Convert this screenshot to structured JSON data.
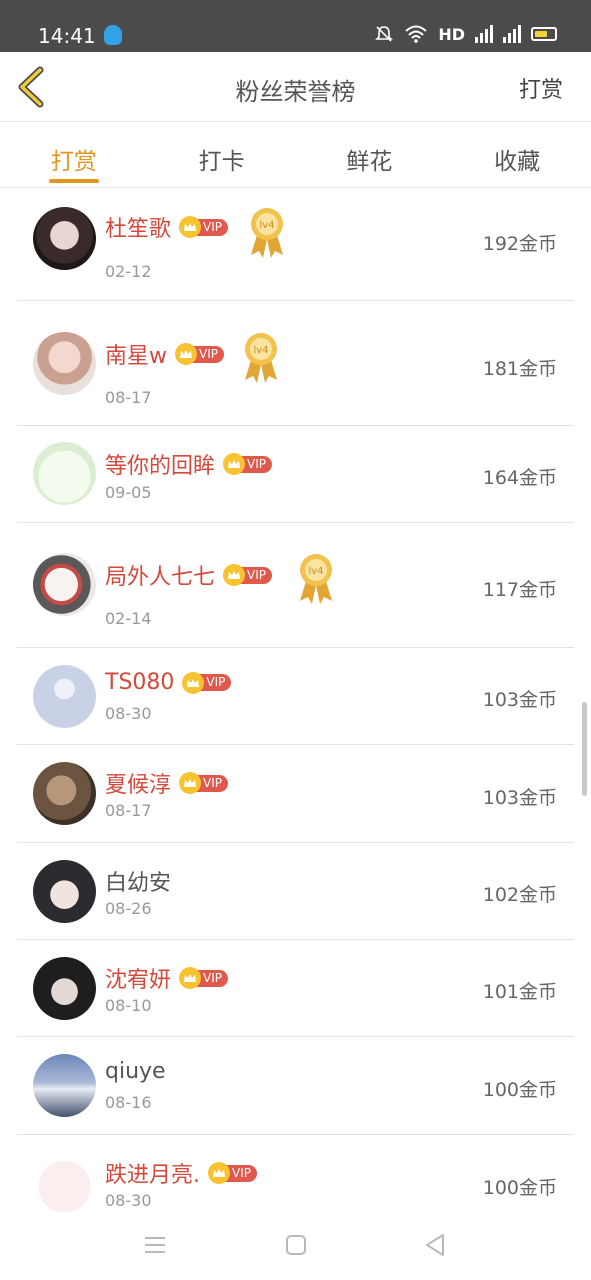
{
  "status_bar": {
    "time": "14:41",
    "network": "HD",
    "network_sub": "4G"
  },
  "nav": {
    "title": "粉丝荣誉榜",
    "action": "打赏"
  },
  "tabs": [
    {
      "label": "打赏",
      "active": true
    },
    {
      "label": "打卡",
      "active": false
    },
    {
      "label": "鲜花",
      "active": false
    },
    {
      "label": "收藏",
      "active": false
    }
  ],
  "colors": {
    "accent": "#e3961e",
    "vip_red": "#e0594c",
    "name_red": "#d4493b",
    "crown": "#f7c331"
  },
  "medal_label": "lv4",
  "list": [
    {
      "name": "杜笙歌",
      "vip": true,
      "medal": true,
      "date": "02-12",
      "coins": "192金币"
    },
    {
      "name": "南星w",
      "vip": true,
      "medal": true,
      "date": "08-17",
      "coins": "181金币"
    },
    {
      "name": "等你的回眸",
      "vip": true,
      "medal": false,
      "date": "09-05",
      "coins": "164金币"
    },
    {
      "name": "局外人七七",
      "vip": true,
      "medal": true,
      "date": "02-14",
      "coins": "117金币"
    },
    {
      "name": "TS080",
      "vip": true,
      "medal": false,
      "date": "08-30",
      "coins": "103金币"
    },
    {
      "name": "夏候淳",
      "vip": true,
      "medal": false,
      "date": "08-17",
      "coins": "103金币"
    },
    {
      "name": "白幼安",
      "vip": false,
      "medal": false,
      "date": "08-26",
      "coins": "102金币"
    },
    {
      "name": "沈宥妍",
      "vip": true,
      "medal": false,
      "date": "08-10",
      "coins": "101金币"
    },
    {
      "name": "qiuye",
      "vip": false,
      "medal": false,
      "date": "08-16",
      "coins": "100金币"
    },
    {
      "name": "跌进月亮.",
      "vip": true,
      "medal": false,
      "date": "08-30",
      "coins": "100金币"
    }
  ],
  "vip_label": "VIP"
}
